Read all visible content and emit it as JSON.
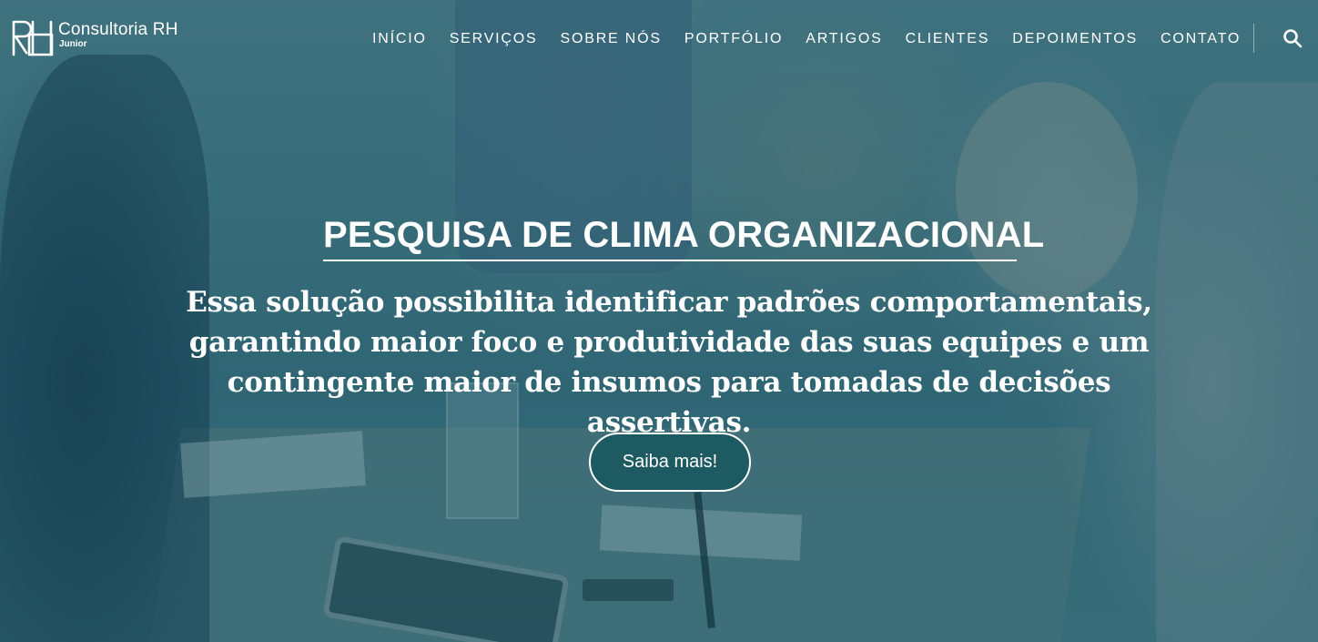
{
  "brand": {
    "name": "Consultoria RH",
    "sub": "Junior",
    "logo_icon": "rh-logo-icon"
  },
  "nav": {
    "items": [
      {
        "label": "INÍCIO"
      },
      {
        "label": "SERVIÇOS"
      },
      {
        "label": "SOBRE NÓS"
      },
      {
        "label": "PORTFÓLIO"
      },
      {
        "label": "ARTIGOS"
      },
      {
        "label": "CLIENTES"
      },
      {
        "label": "DEPOIMENTOS"
      },
      {
        "label": "CONTATO"
      }
    ],
    "search_icon": "search-icon"
  },
  "hero": {
    "title": "PESQUISA DE CLIMA ORGANIZACIONAL",
    "description": "Essa solução possibilita identificar padrões comportamentais, garantindo maior foco e produtividade das suas equipes e um contingente maior de insumos para tomadas de decisões assertivas.",
    "cta_label": "Saiba mais!",
    "cta_color": "#1e5a62",
    "overlay_color": "#1c5866"
  }
}
